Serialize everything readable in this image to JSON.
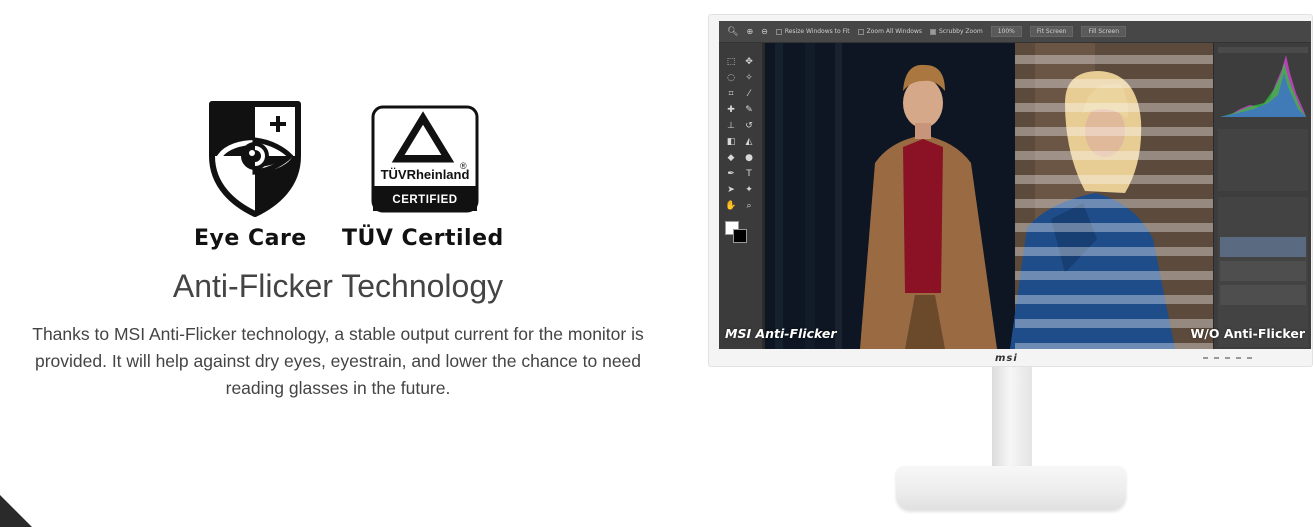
{
  "features": {
    "eye_care": {
      "label": "Eye Care",
      "icon": "eye-shield-icon"
    },
    "tuv": {
      "label": "TÜV Certiled",
      "icon": "tuv-rheinland-logo",
      "logo_brand": "TÜVRheinland",
      "logo_registered": "®",
      "logo_badge": "CERTIFIED"
    }
  },
  "section": {
    "title": "Anti-Flicker Technology",
    "description": "Thanks to MSI Anti-Flicker technology, a stable output current for the monitor is provided. It will help against dry eyes, eyestrain, and lower the chance to need reading glasses in the future."
  },
  "monitor": {
    "left_overlay": "MSI Anti-Flicker",
    "right_overlay": "W/O Anti-Flicker",
    "chin_logo": "msi",
    "toolbar": {
      "resize": "Resize Windows to Fit",
      "zoom_all": "Zoom All Windows",
      "scrubby": "Scrubby Zoom",
      "zoom_level": "100%",
      "fit_screen": "Fit Screen",
      "fill_screen": "Fill Screen"
    }
  },
  "colors": {
    "heading_text": "#444444",
    "badge_text": "#111111",
    "overlay_text": "#ffffff",
    "screen_bg": "#2a2a2a"
  }
}
